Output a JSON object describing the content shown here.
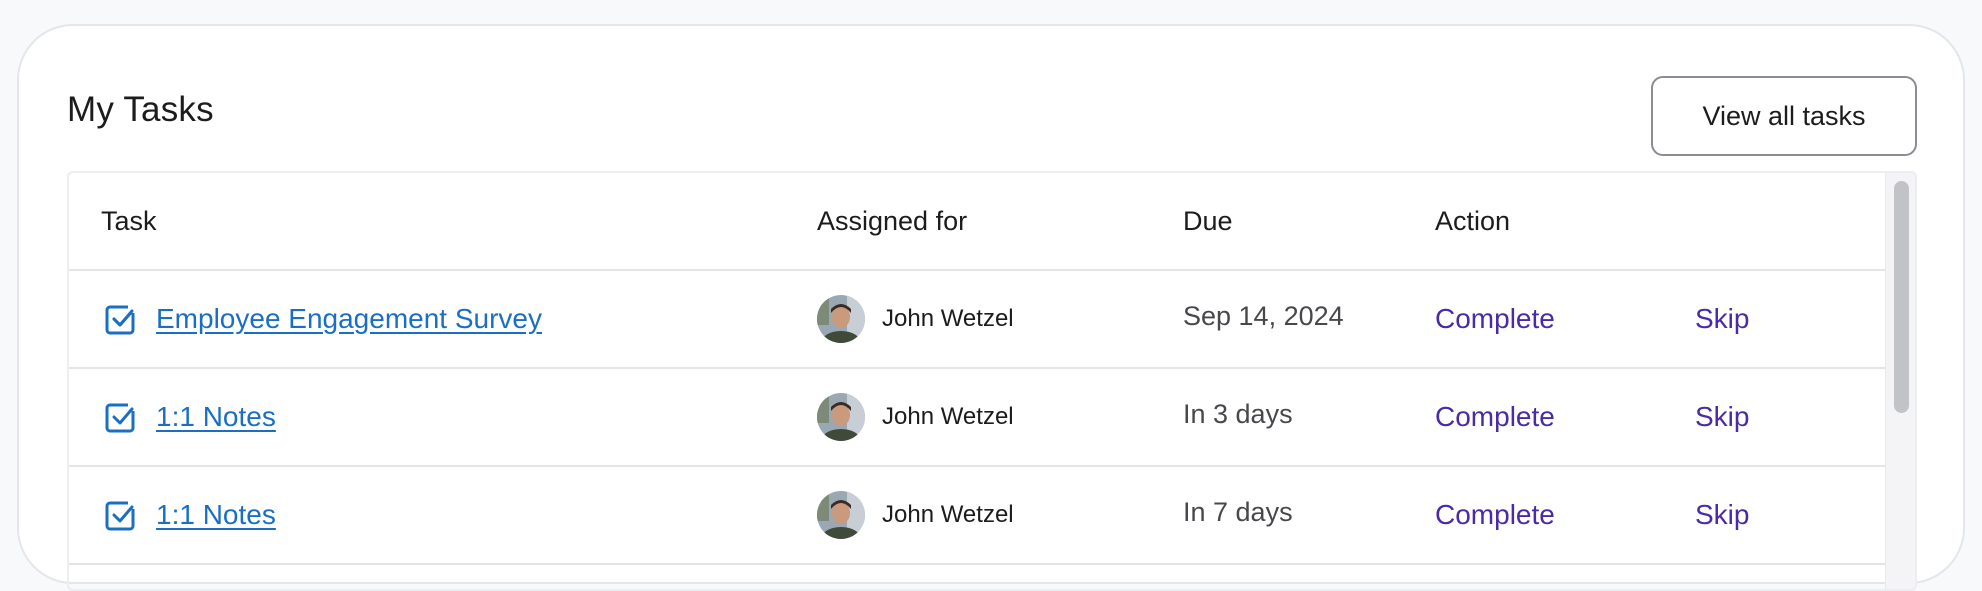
{
  "card": {
    "title": "My Tasks",
    "view_all_label": "View all tasks"
  },
  "table": {
    "columns": {
      "task": "Task",
      "assigned": "Assigned for",
      "due": "Due",
      "action": "Action"
    },
    "rows": [
      {
        "task": "Employee Engagement Survey",
        "assignee": "John Wetzel",
        "due": "Sep 14, 2024",
        "complete_label": "Complete",
        "skip_label": "Skip"
      },
      {
        "task": "1:1 Notes",
        "assignee": "John Wetzel",
        "due": "In 3 days",
        "complete_label": "Complete",
        "skip_label": "Skip"
      },
      {
        "task": "1:1 Notes",
        "assignee": "John Wetzel",
        "due": "In 7 days",
        "complete_label": "Complete",
        "skip_label": "Skip"
      }
    ]
  },
  "icons": {
    "task": "checkbox-icon",
    "assignee": "avatar"
  },
  "colors": {
    "link": "#1a6fc4",
    "action": "#4b2aa8",
    "text": "#1c1c1e"
  }
}
